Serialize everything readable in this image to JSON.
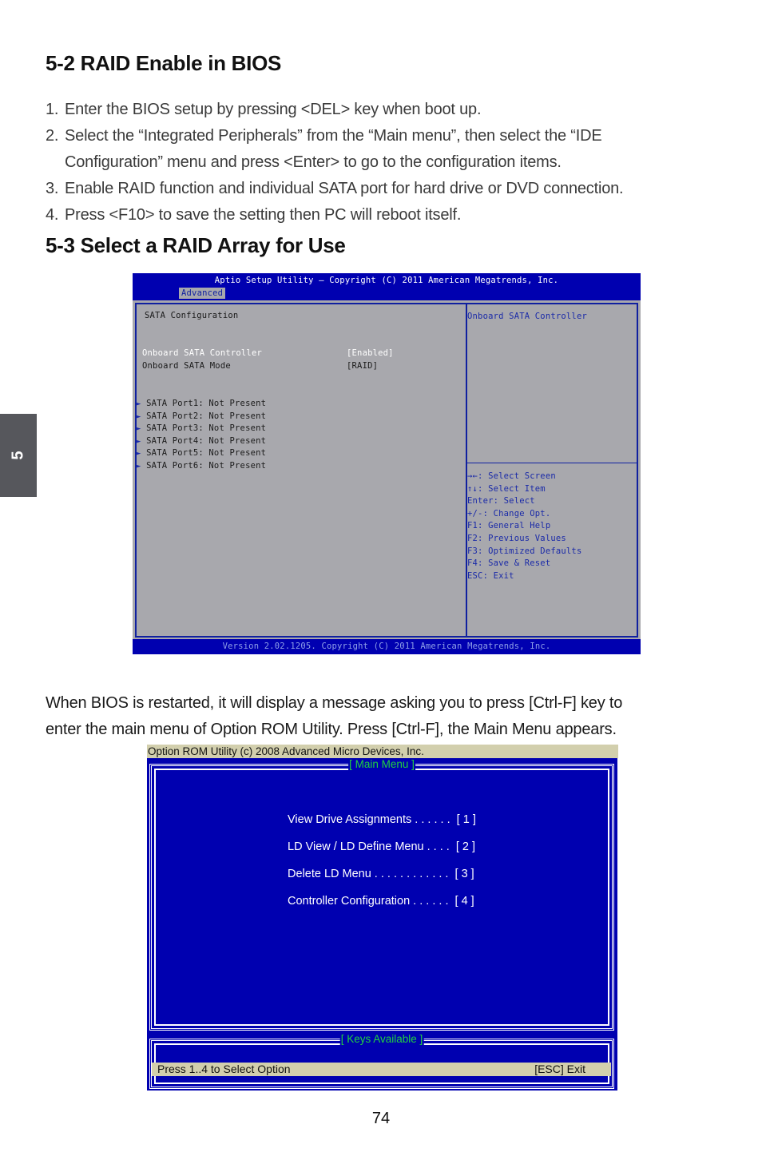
{
  "section_52": {
    "title": "5-2 RAID Enable in BIOS",
    "steps": [
      {
        "num": "1.",
        "text": "Enter the BIOS setup by pressing <DEL> key when boot up."
      },
      {
        "num": "2.",
        "text": "Select the “Integrated Peripherals” from the “Main menu”, then select the “IDE",
        "cont": "Configuration” menu and press <Enter> to go to the configuration items."
      },
      {
        "num": "3.",
        "text": "Enable RAID function and individual SATA port for hard drive or DVD connection."
      },
      {
        "num": "4.",
        "text": "Press <F10> to save the setting then PC will reboot itself."
      }
    ]
  },
  "section_53": {
    "title": "5-3 Select a RAID Array for Use"
  },
  "chapter_tab": "5",
  "bios": {
    "title": "Aptio Setup Utility – Copyright (C) 2011 American Megatrends, Inc.",
    "active_tab": "Advanced",
    "section_heading": "SATA Configuration",
    "settings": [
      {
        "label": "Onboard SATA Controller",
        "value": "[Enabled]",
        "selected": true
      },
      {
        "label": "Onboard SATA Mode",
        "value": "[RAID]",
        "selected": false
      }
    ],
    "ports": [
      "SATA Port1: Not Present",
      "SATA Port2: Not Present",
      "SATA Port3: Not Present",
      "SATA Port4: Not Present",
      "SATA Port5: Not Present",
      "SATA Port6: Not Present"
    ],
    "help_title": "Onboard SATA Controller",
    "keys": [
      "→←: Select Screen",
      "↑↓: Select Item",
      "Enter: Select",
      "+/-: Change Opt.",
      "F1: General Help",
      "F2: Previous Values",
      "F3: Optimized Defaults",
      "F4: Save & Reset",
      "ESC: Exit"
    ],
    "footer": "Version 2.02.1205. Copyright (C) 2011 American Megatrends, Inc."
  },
  "paragraph": {
    "line1": "When BIOS is restarted, it will display a message asking you to press [Ctrl-F] key to",
    "line2": "enter the main menu of Option ROM Utility. Press [Ctrl-F], the Main Menu appears."
  },
  "rom": {
    "title": "Option ROM Utility (c) 2008 Advanced Micro Devices, Inc.",
    "main_menu_label": "[ Main Menu ]",
    "items": [
      "View Drive Assignments . . . . . .  [ 1 ]",
      "LD View / LD Define Menu . . . .  [ 2 ]",
      "Delete LD Menu . . . . . . . . . . . .  [ 3 ]",
      "Controller Configuration . . . . . .  [ 4 ]"
    ],
    "keys_label": "[ Keys Available ]",
    "status_left": "Press 1..4 to Select Option",
    "status_right": "[ESC] Exit"
  },
  "page_number": "74"
}
